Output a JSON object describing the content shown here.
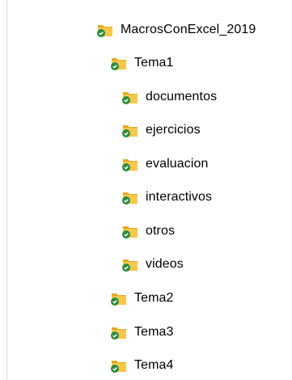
{
  "tree": {
    "root": {
      "label": "MacrosConExcel_2019",
      "icon": "folder-synced-icon",
      "status": "synced"
    },
    "tema1": {
      "label": "Tema1",
      "icon": "folder-synced-icon",
      "status": "synced",
      "children": [
        {
          "label": "documentos",
          "icon": "folder-synced-icon",
          "status": "synced"
        },
        {
          "label": "ejercicios",
          "icon": "folder-synced-icon",
          "status": "synced"
        },
        {
          "label": "evaluacion",
          "icon": "folder-synced-icon",
          "status": "synced"
        },
        {
          "label": "interactivos",
          "icon": "folder-synced-icon",
          "status": "synced"
        },
        {
          "label": "otros",
          "icon": "folder-synced-icon",
          "status": "synced"
        },
        {
          "label": "videos",
          "icon": "folder-synced-icon",
          "status": "synced"
        }
      ]
    },
    "siblings": [
      {
        "label": "Tema2",
        "icon": "folder-synced-icon",
        "status": "synced"
      },
      {
        "label": "Tema3",
        "icon": "folder-synced-icon",
        "status": "synced"
      },
      {
        "label": "Tema4",
        "icon": "folder-synced-icon",
        "status": "synced"
      }
    ]
  },
  "colors": {
    "folder_body": "#f5c84c",
    "folder_back": "#e0a823",
    "sync_badge": "#2e8b3e",
    "check": "#ffffff",
    "border": "#d9d9d9"
  }
}
